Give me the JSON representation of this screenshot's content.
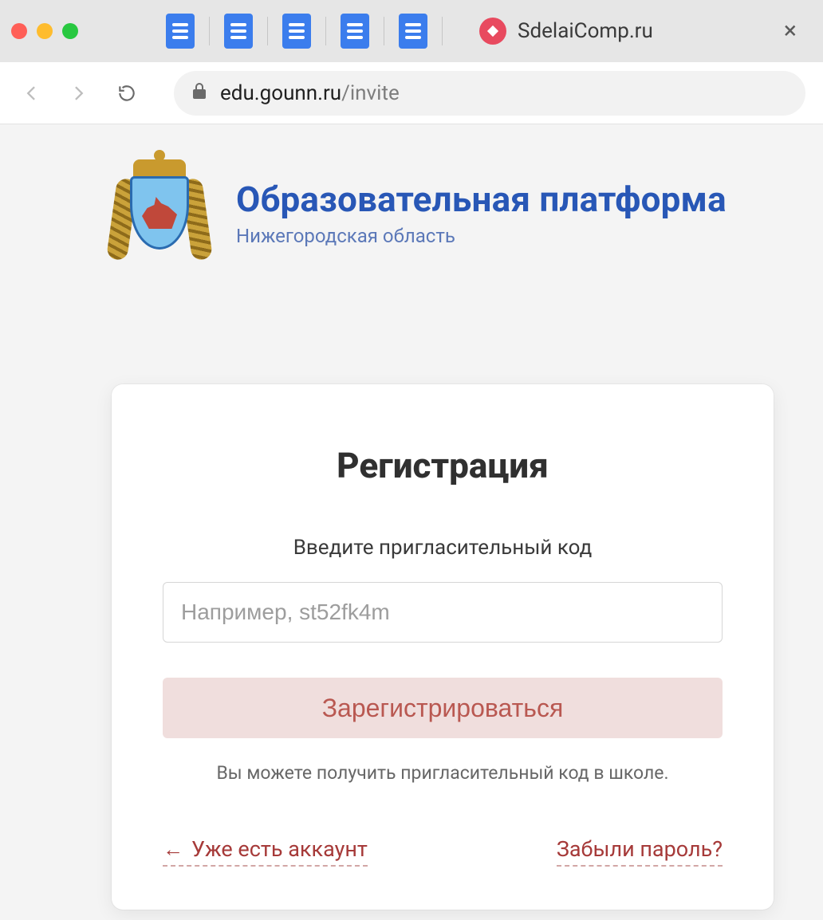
{
  "browser": {
    "tab_title": "SdelaiComp.ru",
    "url_host": "edu.gounn.ru",
    "url_path": "/invite"
  },
  "brand": {
    "title": "Образовательная платформа",
    "subtitle": "Нижегородская область"
  },
  "card": {
    "heading": "Регистрация",
    "lead": "Введите пригласительный код",
    "placeholder": "Например, st52fk4m",
    "submit_label": "Зарегистрироваться",
    "hint": "Вы можете получить пригласительный код в школе.",
    "have_account": "Уже есть аккаунт",
    "forgot": "Забыли пароль?"
  }
}
